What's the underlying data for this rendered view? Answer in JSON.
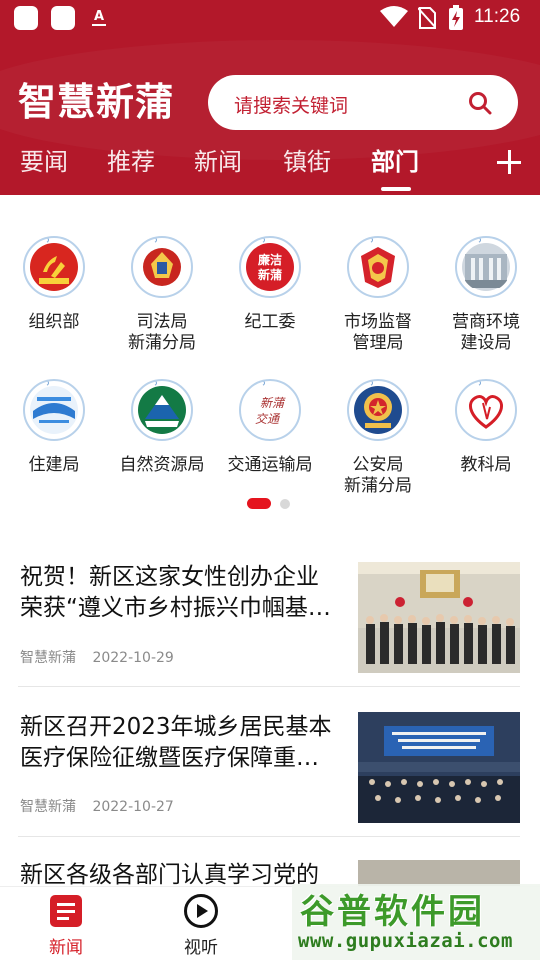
{
  "status_bar": {
    "time": "11:26"
  },
  "header": {
    "app_title": "智慧新蒲",
    "search_placeholder": "请搜索关键词",
    "tabs": [
      {
        "label": "要闻"
      },
      {
        "label": "推荐"
      },
      {
        "label": "新闻"
      },
      {
        "label": "镇街"
      },
      {
        "label": "部门",
        "active": true
      }
    ],
    "accent": "#b3182a"
  },
  "departments": [
    {
      "name": "组织部",
      "icon": "party-emblem-icon"
    },
    {
      "name": "司法局\n新蒲分局",
      "icon": "justice-emblem-icon"
    },
    {
      "name": "纪工委",
      "icon": "lianjie-xinpu-icon",
      "icon_text": "廉洁\n新蒲"
    },
    {
      "name": "市场监督\n管理局",
      "icon": "market-supervision-emblem-icon"
    },
    {
      "name": "营商环境\n建设局",
      "icon": "building-photo-icon"
    },
    {
      "name": "住建局",
      "icon": "housing-construction-logo-icon"
    },
    {
      "name": "自然资源局",
      "icon": "natural-resources-emblem-icon"
    },
    {
      "name": "交通运输局",
      "icon": "xinpu-jiaotong-calligraphy-icon"
    },
    {
      "name": "公安局\n新蒲分局",
      "icon": "police-emblem-icon"
    },
    {
      "name": "教科局",
      "icon": "education-heart-icon"
    }
  ],
  "pager": {
    "pages": 2,
    "active": 1
  },
  "news": [
    {
      "title": "祝贺！新区这家女性创办企业荣获“遵义市乡村振兴巾帼基…",
      "source": "智慧新蒲",
      "date": "2022-10-29"
    },
    {
      "title": "新区召开2023年城乡居民基本医疗保险征缴暨医疗保障重…",
      "source": "智慧新蒲",
      "date": "2022-10-27"
    },
    {
      "title": "新区各级各部门认真学习党的",
      "source": "",
      "date": ""
    }
  ],
  "bottom_nav": [
    {
      "label": "新闻",
      "icon": "news-list-icon",
      "active": true
    },
    {
      "label": "视听",
      "icon": "play-circle-icon",
      "active": false
    }
  ],
  "watermark": {
    "text": "谷普软件园",
    "url": "www.gupuxiazai.com"
  }
}
